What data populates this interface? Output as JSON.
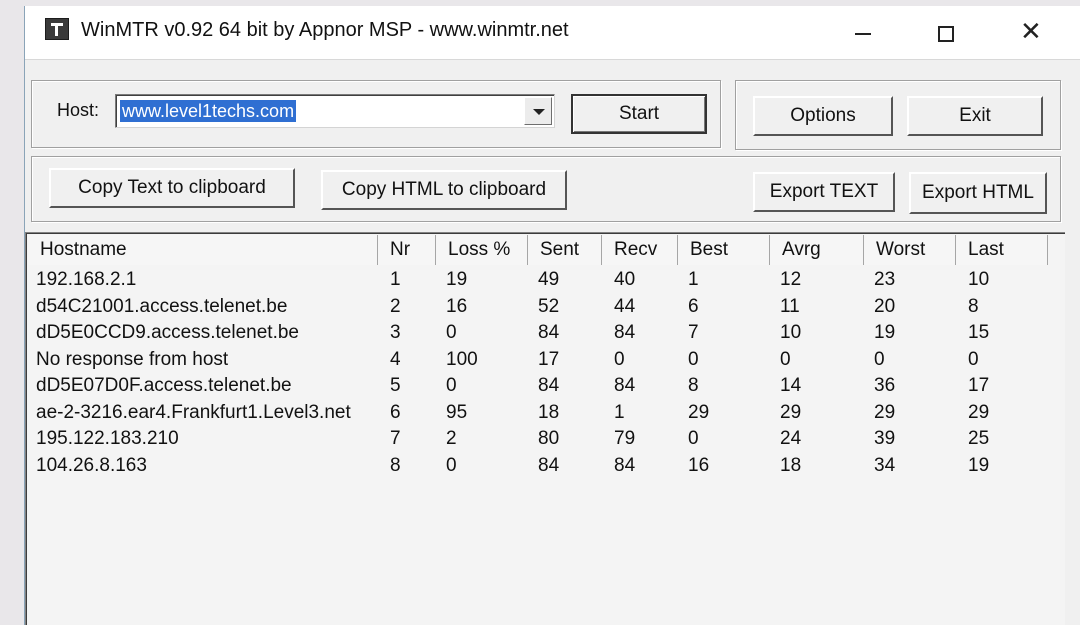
{
  "window": {
    "title": "WinMTR v0.92 64 bit by Appnor MSP - www.winmtr.net"
  },
  "host": {
    "label": "Host:",
    "value": "www.level1techs.com"
  },
  "buttons": {
    "start": "Start",
    "options": "Options",
    "exit": "Exit",
    "copy_text": "Copy Text to clipboard",
    "copy_html": "Copy HTML to clipboard",
    "export_text": "Export TEXT",
    "export_html": "Export HTML"
  },
  "table": {
    "columns": [
      "Hostname",
      "Nr",
      "Loss %",
      "Sent",
      "Recv",
      "Best",
      "Avrg",
      "Worst",
      "Last"
    ],
    "rows": [
      [
        "192.168.2.1",
        "1",
        "19",
        "49",
        "40",
        "1",
        "12",
        "23",
        "10"
      ],
      [
        "d54C21001.access.telenet.be",
        "2",
        "16",
        "52",
        "44",
        "6",
        "11",
        "20",
        "8"
      ],
      [
        "dD5E0CCD9.access.telenet.be",
        "3",
        "0",
        "84",
        "84",
        "7",
        "10",
        "19",
        "15"
      ],
      [
        "No response from host",
        "4",
        "100",
        "17",
        "0",
        "0",
        "0",
        "0",
        "0"
      ],
      [
        "dD5E07D0F.access.telenet.be",
        "5",
        "0",
        "84",
        "84",
        "8",
        "14",
        "36",
        "17"
      ],
      [
        "ae-2-3216.ear4.Frankfurt1.Level3.net",
        "6",
        "95",
        "18",
        "1",
        "29",
        "29",
        "29",
        "29"
      ],
      [
        "195.122.183.210",
        "7",
        "2",
        "80",
        "79",
        "0",
        "24",
        "39",
        "25"
      ],
      [
        "104.26.8.163",
        "8",
        "0",
        "84",
        "84",
        "16",
        "18",
        "34",
        "19"
      ]
    ]
  },
  "colors": {
    "selection": "#2f6fd2",
    "window_bg": "#f0f0f0"
  }
}
